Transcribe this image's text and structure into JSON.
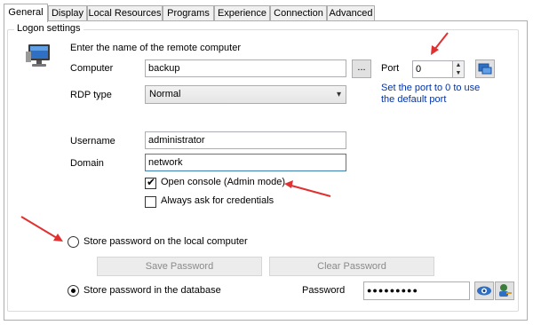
{
  "tabs": [
    {
      "label": "General"
    },
    {
      "label": "Display"
    },
    {
      "label": "Local Resources"
    },
    {
      "label": "Programs"
    },
    {
      "label": "Experience"
    },
    {
      "label": "Connection"
    },
    {
      "label": "Advanced"
    }
  ],
  "logon": {
    "group_title": "Logon settings",
    "intro": "Enter the name of the remote computer",
    "computer_label": "Computer",
    "computer_value": "backup",
    "browse_label": "...",
    "port_label": "Port",
    "port_value": "0",
    "port_hint_line1": "Set the port to 0 to use",
    "port_hint_line2": "the default port",
    "rdp_type_label": "RDP type",
    "rdp_type_value": "Normal",
    "username_label": "Username",
    "username_value": "administrator",
    "domain_label": "Domain",
    "domain_value": "network",
    "open_console_label": "Open console (Admin mode)",
    "open_console_checked": true,
    "always_ask_label": "Always ask for credentials",
    "always_ask_checked": false
  },
  "password": {
    "store_local_label": "Store password on the local computer",
    "save_password_label": "Save Password",
    "clear_password_label": "Clear Password",
    "store_db_label": "Store password in the database",
    "password_label": "Password",
    "password_value": "●●●●●●●●●"
  },
  "colors": {
    "annotation_arrow": "#e03030",
    "link_text": "#0033aa",
    "focus_border": "#3c7fb1"
  }
}
